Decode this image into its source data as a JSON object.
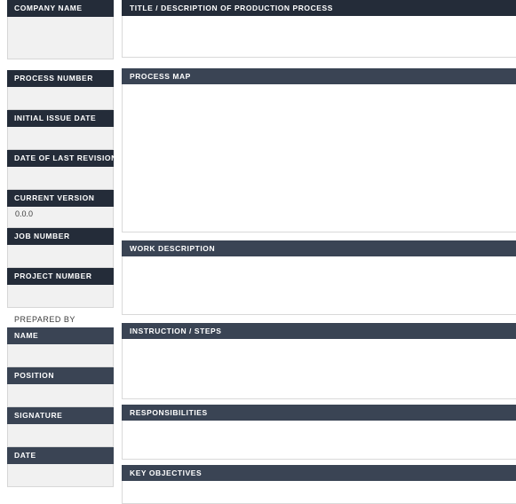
{
  "document": {
    "kind": "standard-operating-procedure-form",
    "background": "#ffffff",
    "accent_dark": "#242c39",
    "accent_slate": "#3a4454",
    "field_fill_left": "#f1f1f1",
    "field_fill_right": "#ffffff"
  },
  "left_column": {
    "fields": [
      {
        "label": "COMPANY NAME",
        "value": ""
      },
      {
        "label": "PROCESS NUMBER",
        "value": ""
      },
      {
        "label": "INITIAL ISSUE DATE",
        "value": ""
      },
      {
        "label": "DATE OF LAST REVISION",
        "value": ""
      },
      {
        "label": "CURRENT VERSION",
        "value": "0.0.0"
      },
      {
        "label": "JOB NUMBER",
        "value": ""
      },
      {
        "label": "PROJECT NUMBER",
        "value": ""
      }
    ],
    "prepared_by": {
      "heading": "PREPARED BY",
      "fields": [
        {
          "label": "NAME",
          "value": ""
        },
        {
          "label": "POSITION",
          "value": ""
        },
        {
          "label": "SIGNATURE",
          "value": ""
        },
        {
          "label": "DATE",
          "value": ""
        }
      ]
    }
  },
  "right_column": {
    "sections": [
      {
        "label": "TITLE / DESCRIPTION OF PRODUCTION PROCESS",
        "value": ""
      },
      {
        "label": "PROCESS MAP",
        "value": ""
      },
      {
        "label": "WORK DESCRIPTION",
        "value": ""
      },
      {
        "label": "INSTRUCTION / STEPS",
        "value": ""
      },
      {
        "label": "RESPONSIBILITIES",
        "value": ""
      },
      {
        "label": "KEY OBJECTIVES",
        "value": ""
      }
    ]
  }
}
